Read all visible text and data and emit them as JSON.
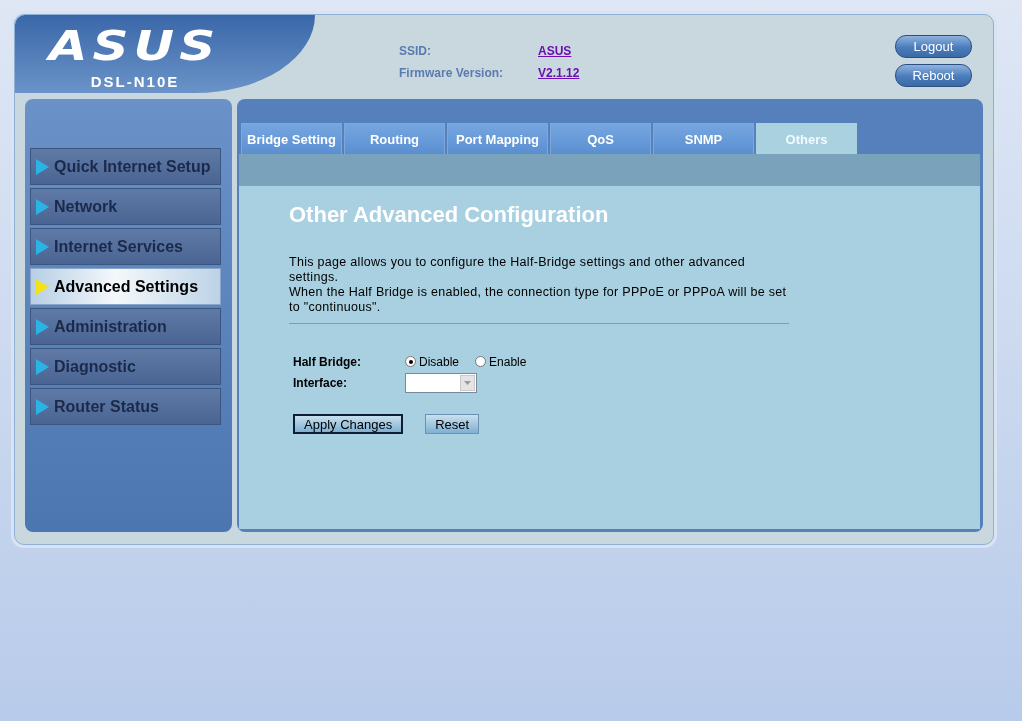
{
  "header": {
    "logo": "ASUS",
    "model": "DSL-N10E",
    "info": [
      {
        "label": "SSID:",
        "value": "ASUS"
      },
      {
        "label": "Firmware Version:",
        "value": "V2.1.12"
      }
    ],
    "buttons": [
      "Logout",
      "Reboot"
    ]
  },
  "menu": [
    {
      "label": "Quick Internet Setup",
      "selected": false
    },
    {
      "label": "Network",
      "selected": false
    },
    {
      "label": "Internet Services",
      "selected": false
    },
    {
      "label": "Advanced Settings",
      "selected": true
    },
    {
      "label": "Administration",
      "selected": false
    },
    {
      "label": "Diagnostic",
      "selected": false
    },
    {
      "label": "Router Status",
      "selected": false
    }
  ],
  "tabs": [
    {
      "label": "Bridge Setting",
      "selected": false
    },
    {
      "label": "Routing",
      "selected": false
    },
    {
      "label": "Port Mapping",
      "selected": false
    },
    {
      "label": "QoS",
      "selected": false
    },
    {
      "label": "SNMP",
      "selected": false
    },
    {
      "label": "Others",
      "selected": true
    }
  ],
  "page": {
    "title": "Other Advanced Configuration",
    "description": [
      "This page allows you to configure the Half-Bridge settings and other advanced settings.",
      "When the Half Bridge is enabled, the connection type for PPPoE or PPPoA will be set to \"continuous\"."
    ],
    "half_bridge": {
      "label": "Half Bridge:",
      "options": [
        {
          "label": "Disable",
          "selected": true
        },
        {
          "label": "Enable",
          "selected": false
        }
      ]
    },
    "interface": {
      "label": "Interface:"
    },
    "buttons": [
      {
        "label": "Apply Changes",
        "focused": true
      },
      {
        "label": "Reset",
        "focused": false
      }
    ]
  }
}
